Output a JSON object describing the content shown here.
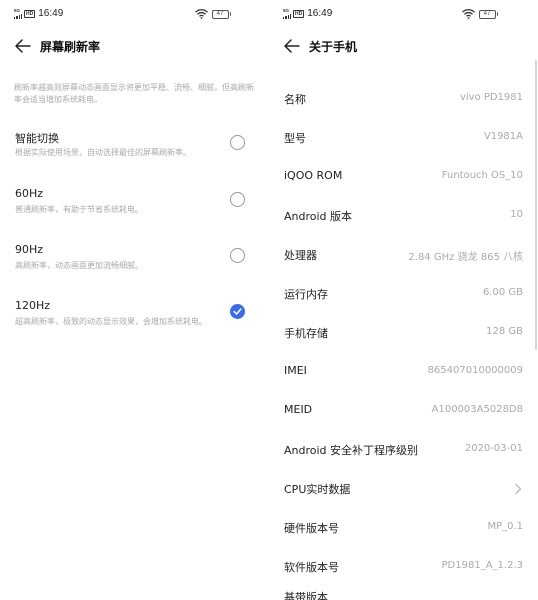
{
  "status_bar": {
    "time": "16:49",
    "network": "5G",
    "hd": "HD",
    "battery": "47"
  },
  "left": {
    "title": "屏幕刷新率",
    "intro": "刷新率越高则屏幕动态画面显示将更加平稳、流畅、细腻，但高刷新率会适当增加系统耗电。",
    "options": [
      {
        "title": "智能切换",
        "desc": "根据实际使用场景，自动选择最佳的屏幕刷新率。",
        "checked": false
      },
      {
        "title": "60Hz",
        "desc": "普通刷新率，有助于节省系统耗电。",
        "checked": false
      },
      {
        "title": "90Hz",
        "desc": "高刷新率，动态画面更加流畅细腻。",
        "checked": false
      },
      {
        "title": "120Hz",
        "desc": "超高刷新率，极致的动态显示效果，会增加系统耗电。",
        "checked": true
      }
    ]
  },
  "right": {
    "title": "关于手机",
    "rows": [
      {
        "label": "名称",
        "value": "vivo PD1981"
      },
      {
        "label": "型号",
        "value": "V1981A"
      },
      {
        "label": "iQOO ROM",
        "value": "Funtouch OS_10"
      },
      {
        "label": "Android 版本",
        "value": "10"
      },
      {
        "label": "处理器",
        "value": "2.84 GHz 骁龙 865 八核"
      },
      {
        "label": "运行内存",
        "value": "6.00 GB"
      },
      {
        "label": "手机存储",
        "value": "128 GB"
      },
      {
        "label": "IMEI",
        "value": "865407010000009"
      },
      {
        "label": "MEID",
        "value": "A100003A5028D8"
      },
      {
        "label": "Android 安全补丁程序级别",
        "value": "2020-03-01"
      },
      {
        "label": "CPU实时数据",
        "value": ""
      },
      {
        "label": "硬件版本号",
        "value": "MP_0.1"
      },
      {
        "label": "软件版本号",
        "value": "PD1981_A_1.2.3"
      },
      {
        "label": "基带版本",
        "value": ""
      }
    ]
  },
  "icons": {
    "back": "arrow-left-icon",
    "wifi": "wifi-icon",
    "chevron": "chevron-right-icon",
    "check": "check-icon"
  },
  "colors": {
    "accent": "#3a6ce6",
    "secondary_text": "#aaaaaa"
  }
}
